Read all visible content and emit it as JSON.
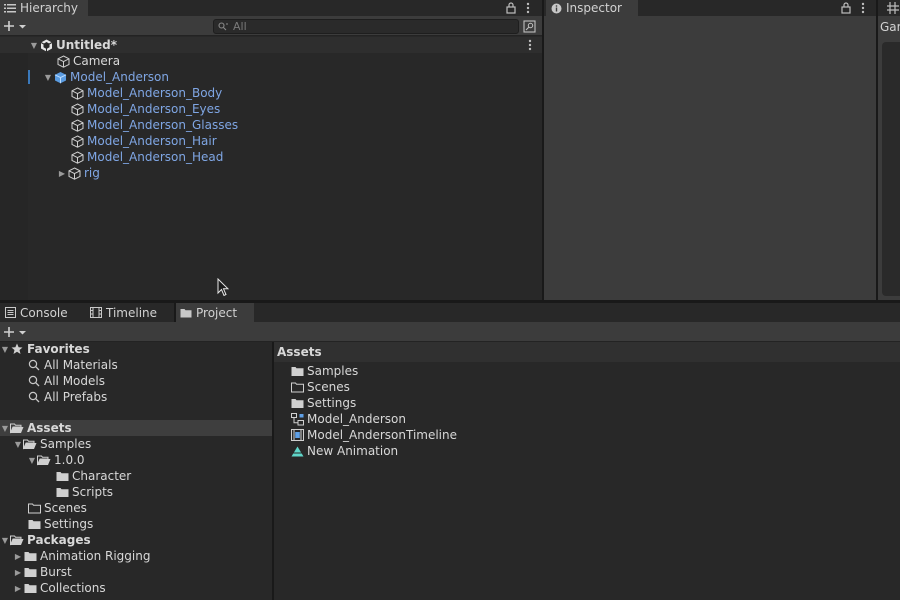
{
  "hierarchy": {
    "tab_label": "Hierarchy",
    "search_placeholder": "All",
    "scene_name": "Untitled*",
    "items": [
      {
        "label": "Camera"
      },
      {
        "label": "Model_Anderson"
      },
      {
        "label": "Model_Anderson_Body"
      },
      {
        "label": "Model_Anderson_Eyes"
      },
      {
        "label": "Model_Anderson_Glasses"
      },
      {
        "label": "Model_Anderson_Hair"
      },
      {
        "label": "Model_Anderson_Head"
      },
      {
        "label": "rig"
      }
    ]
  },
  "inspector": {
    "tab_label": "Inspector"
  },
  "game": {
    "tab_label": "Gar"
  },
  "bottom_tabs": {
    "console": "Console",
    "timeline": "Timeline",
    "project": "Project"
  },
  "project_tree": {
    "favorites": {
      "label": "Favorites",
      "items": [
        "All Materials",
        "All Models",
        "All Prefabs"
      ]
    },
    "assets": {
      "label": "Assets",
      "samples": "Samples",
      "version": "1.0.0",
      "character": "Character",
      "scripts": "Scripts",
      "scenes": "Scenes",
      "settings": "Settings"
    },
    "packages": {
      "label": "Packages",
      "items": [
        "Animation Rigging",
        "Burst",
        "Collections"
      ]
    }
  },
  "assets_view": {
    "header": "Assets",
    "items": [
      {
        "label": "Samples",
        "icon": "folder-icon"
      },
      {
        "label": "Scenes",
        "icon": "folder-outline-icon"
      },
      {
        "label": "Settings",
        "icon": "folder-icon"
      },
      {
        "label": "Model_Anderson",
        "icon": "prefab-hierarchy-icon"
      },
      {
        "label": "Model_AndersonTimeline",
        "icon": "timeline-asset-icon"
      },
      {
        "label": "New Animation",
        "icon": "animation-clip-icon"
      }
    ]
  },
  "colors": {
    "selected_blue": "#7fa6e4",
    "panel_bg": "#282828",
    "active_tab": "#3c3c3c",
    "selection_indicator": "#3a79bb",
    "animation_icon": "#5fd6c9"
  }
}
